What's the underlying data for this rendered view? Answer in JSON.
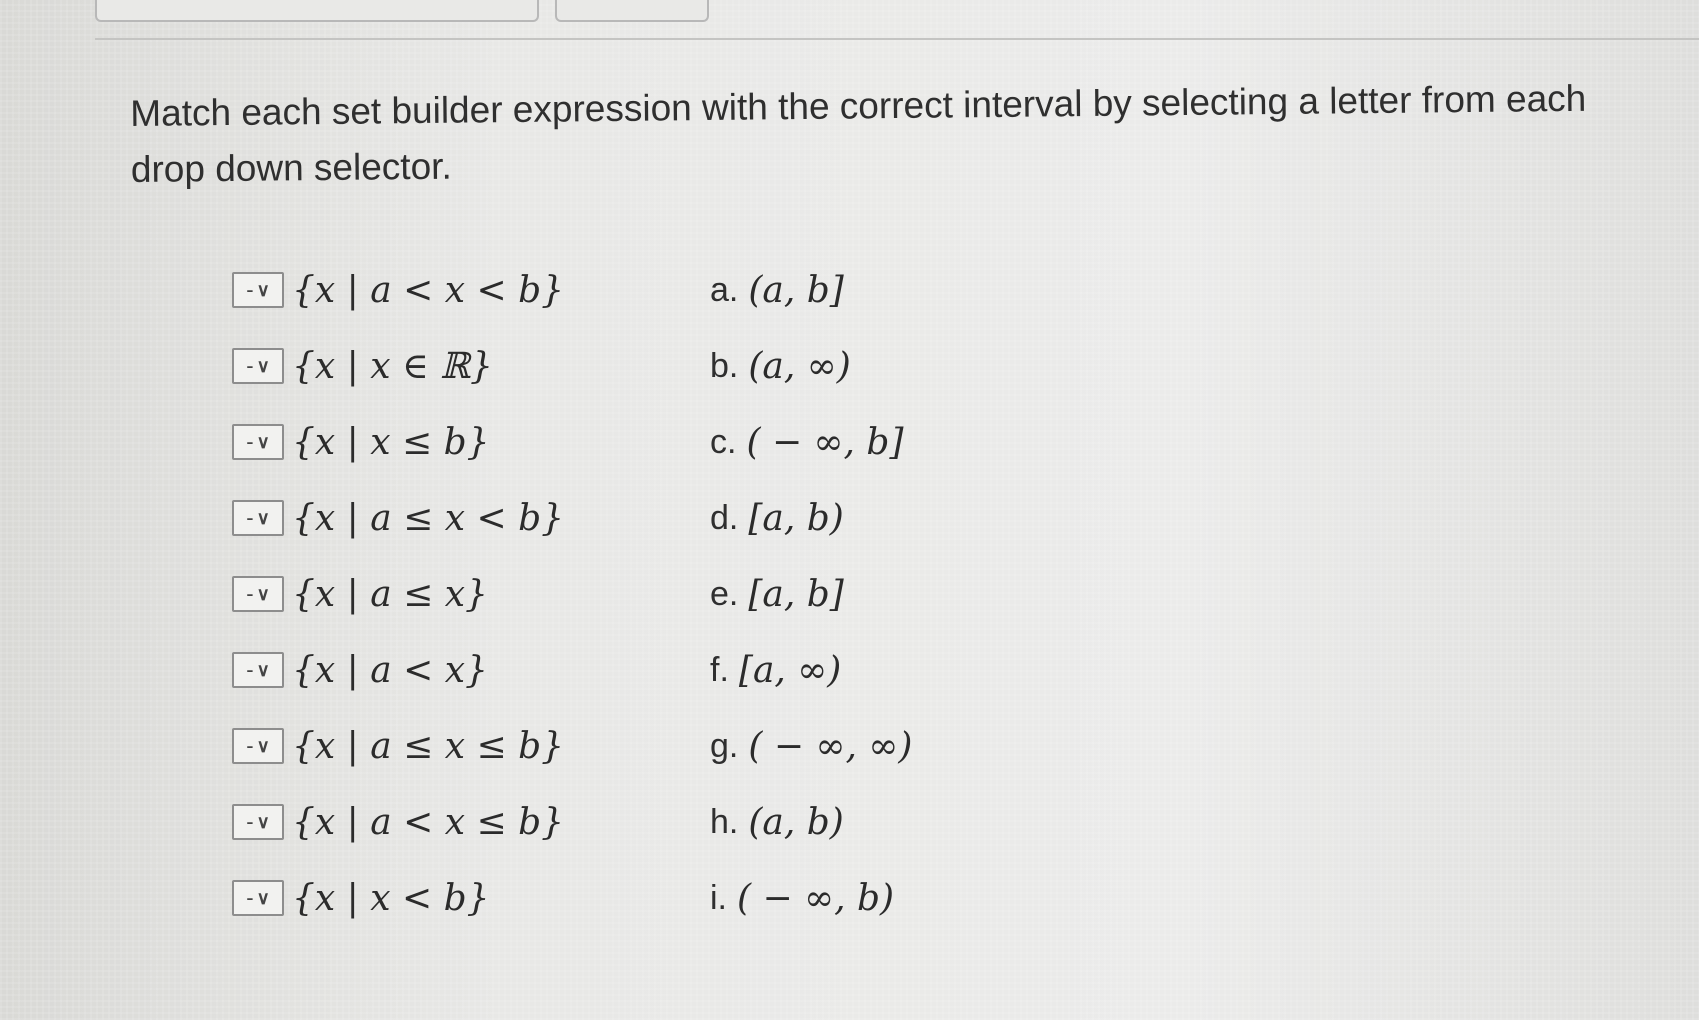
{
  "instructions": "Match each set builder expression with the correct interval by selecting a letter from each drop down selector.",
  "selector_placeholder": "-",
  "rows": [
    {
      "expression": "{x | a < x < b}",
      "letter": "a.",
      "interval": "(a, b]"
    },
    {
      "expression": "{x | x ∈ ℝ}",
      "letter": "b.",
      "interval": "(a, ∞)"
    },
    {
      "expression": "{x | x ≤ b}",
      "letter": "c.",
      "interval": "( − ∞, b]"
    },
    {
      "expression": "{x | a ≤ x < b}",
      "letter": "d.",
      "interval": "[a, b)"
    },
    {
      "expression": "{x | a ≤ x}",
      "letter": "e.",
      "interval": "[a, b]"
    },
    {
      "expression": "{x | a < x}",
      "letter": "f.",
      "interval": "[a, ∞)"
    },
    {
      "expression": "{x | a ≤ x ≤ b}",
      "letter": "g.",
      "interval": "( − ∞, ∞)"
    },
    {
      "expression": "{x | a < x ≤ b}",
      "letter": "h.",
      "interval": "(a, b)"
    },
    {
      "expression": "{x | x < b}",
      "letter": "i.",
      "interval": "( − ∞, b)"
    }
  ]
}
